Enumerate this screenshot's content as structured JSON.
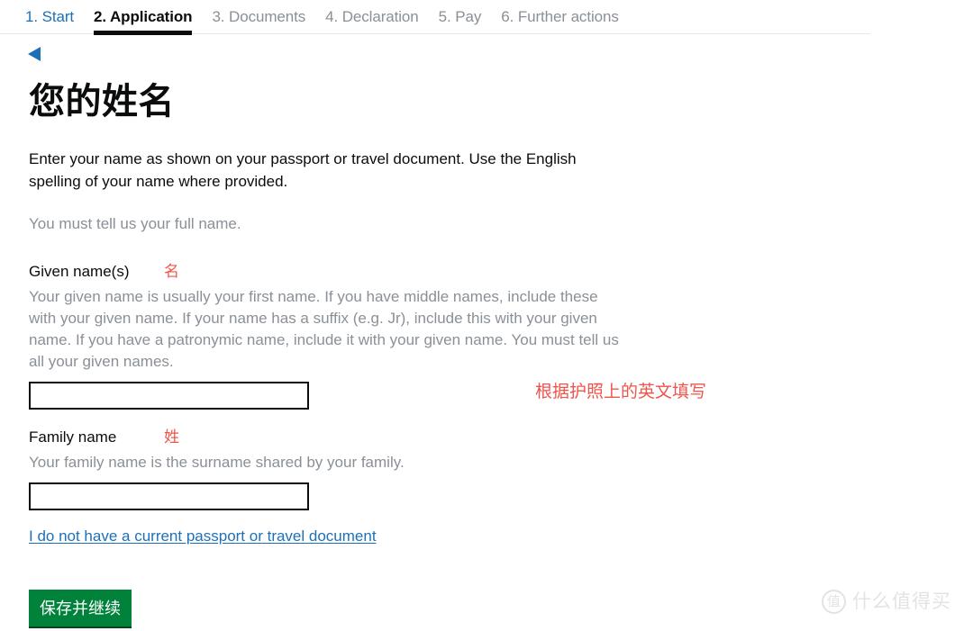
{
  "colors": {
    "link_blue": "#1d70b8",
    "active_black": "#0b0c0c",
    "muted_gray": "#8a9097",
    "annotation_red": "#f0544a",
    "button_green": "#00823b",
    "watermark_gray": "#e2e3e4"
  },
  "steps": [
    {
      "label": "1. Start",
      "state": "link"
    },
    {
      "label": "2. Application",
      "state": "active"
    },
    {
      "label": "3. Documents",
      "state": "muted"
    },
    {
      "label": "4. Declaration",
      "state": "muted"
    },
    {
      "label": "5. Pay",
      "state": "muted"
    },
    {
      "label": "6. Further actions",
      "state": "muted"
    }
  ],
  "back": {
    "icon": "triangle-left-icon"
  },
  "page": {
    "title": "您的姓名",
    "lede": "Enter your name as shown on your passport or travel document. Use the English spelling of your name where provided.",
    "must_tell": "You must tell us your full name."
  },
  "given_name": {
    "label": "Given name(s)",
    "annotation": "名",
    "hint": "Your given name is usually your first name. If you have middle names, include these with your given name. If your name has a suffix (e.g. Jr), include this with your given name. If you have a patronymic name, include it with your given name. You must tell us all your given names.",
    "value": "",
    "placeholder": ""
  },
  "family_name": {
    "label": "Family name",
    "annotation": "姓",
    "hint": "Your family name is the surname shared by your family.",
    "value": "",
    "placeholder": ""
  },
  "no_passport_link": "I do not have a current passport or travel document",
  "side_note": "根据护照上的英文填写",
  "save_button": "保存并继续",
  "watermark": {
    "badge": "值",
    "text": "什么值得买"
  }
}
